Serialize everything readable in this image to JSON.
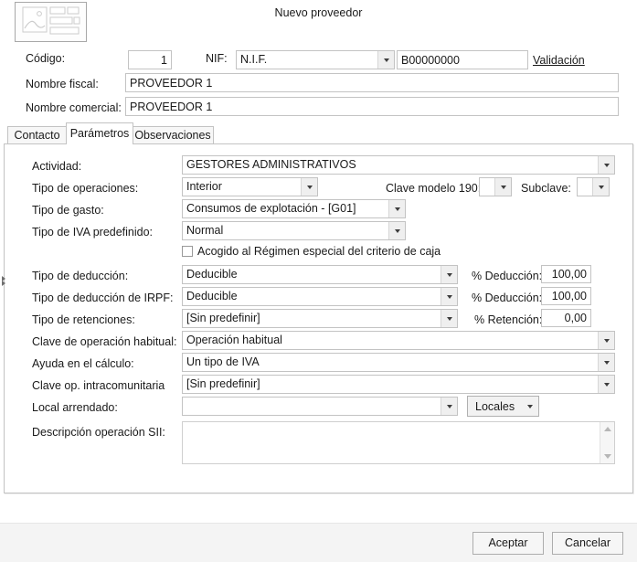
{
  "window": {
    "title": "Nuevo proveedor",
    "icon": "image-placeholder-icon"
  },
  "header": {
    "codigo_label": "Código:",
    "codigo_value": "1",
    "nif_label": "NIF:",
    "nif_type_value": "N.I.F.",
    "nif_number_value": "B00000000",
    "validacion_link": "Validación",
    "nombre_fiscal_label": "Nombre fiscal:",
    "nombre_fiscal_value": "PROVEEDOR 1",
    "nombre_comercial_label": "Nombre comercial:",
    "nombre_comercial_value": "PROVEEDOR 1"
  },
  "tabs": [
    {
      "label": "Contacto",
      "active": false
    },
    {
      "label": "Parámetros",
      "active": true
    },
    {
      "label": "Observaciones",
      "active": false
    }
  ],
  "parametros": {
    "actividad_label": "Actividad:",
    "actividad_value": "GESTORES ADMINISTRATIVOS",
    "tipo_operaciones_label": "Tipo de operaciones:",
    "tipo_operaciones_value": "Interior",
    "clave_modelo_190_label": "Clave modelo 190:",
    "clave_modelo_190_value": "",
    "subclave_label": "Subclave:",
    "subclave_value": "",
    "tipo_gasto_label": "Tipo de gasto:",
    "tipo_gasto_value": "Consumos de explotación - [G01]",
    "tipo_iva_label": "Tipo de IVA predefinido:",
    "tipo_iva_value": "Normal",
    "criterio_caja_label": "Acogido al Régimen especial del criterio de caja",
    "criterio_caja_checked": false,
    "tipo_deduccion_label": "Tipo de deducción:",
    "tipo_deduccion_value": "Deducible",
    "pct_deduccion_label": "% Deducción:",
    "pct_deduccion_value": "100,00",
    "tipo_deduccion_irpf_label": "Tipo de deducción de IRPF:",
    "tipo_deduccion_irpf_value": "Deducible",
    "pct_deduccion_irpf_label": "% Deducción:",
    "pct_deduccion_irpf_value": "100,00",
    "tipo_retenciones_label": "Tipo de retenciones:",
    "tipo_retenciones_value": "[Sin predefinir]",
    "pct_retencion_label": "% Retención:",
    "pct_retencion_value": "0,00",
    "clave_operacion_label": "Clave de operación habitual:",
    "clave_operacion_value": "Operación habitual",
    "ayuda_calculo_label": "Ayuda en el cálculo:",
    "ayuda_calculo_value": "Un tipo de IVA",
    "clave_intracomunitaria_label": "Clave op. intracomunitaria",
    "clave_intracomunitaria_value": "[Sin predefinir]",
    "local_arrendado_label": "Local arrendado:",
    "local_arrendado_value": "",
    "locales_button_label": "Locales",
    "descripcion_sii_label": "Descripción operación SII:",
    "descripcion_sii_value": ""
  },
  "footer": {
    "accept_label": "Aceptar",
    "cancel_label": "Cancelar"
  },
  "colors": {
    "window_bg": "#ffffff",
    "footer_bg": "#f4f4f4",
    "border": "#c3c3c3",
    "combo_button": "#efefef",
    "text": "#1a1a1a"
  }
}
